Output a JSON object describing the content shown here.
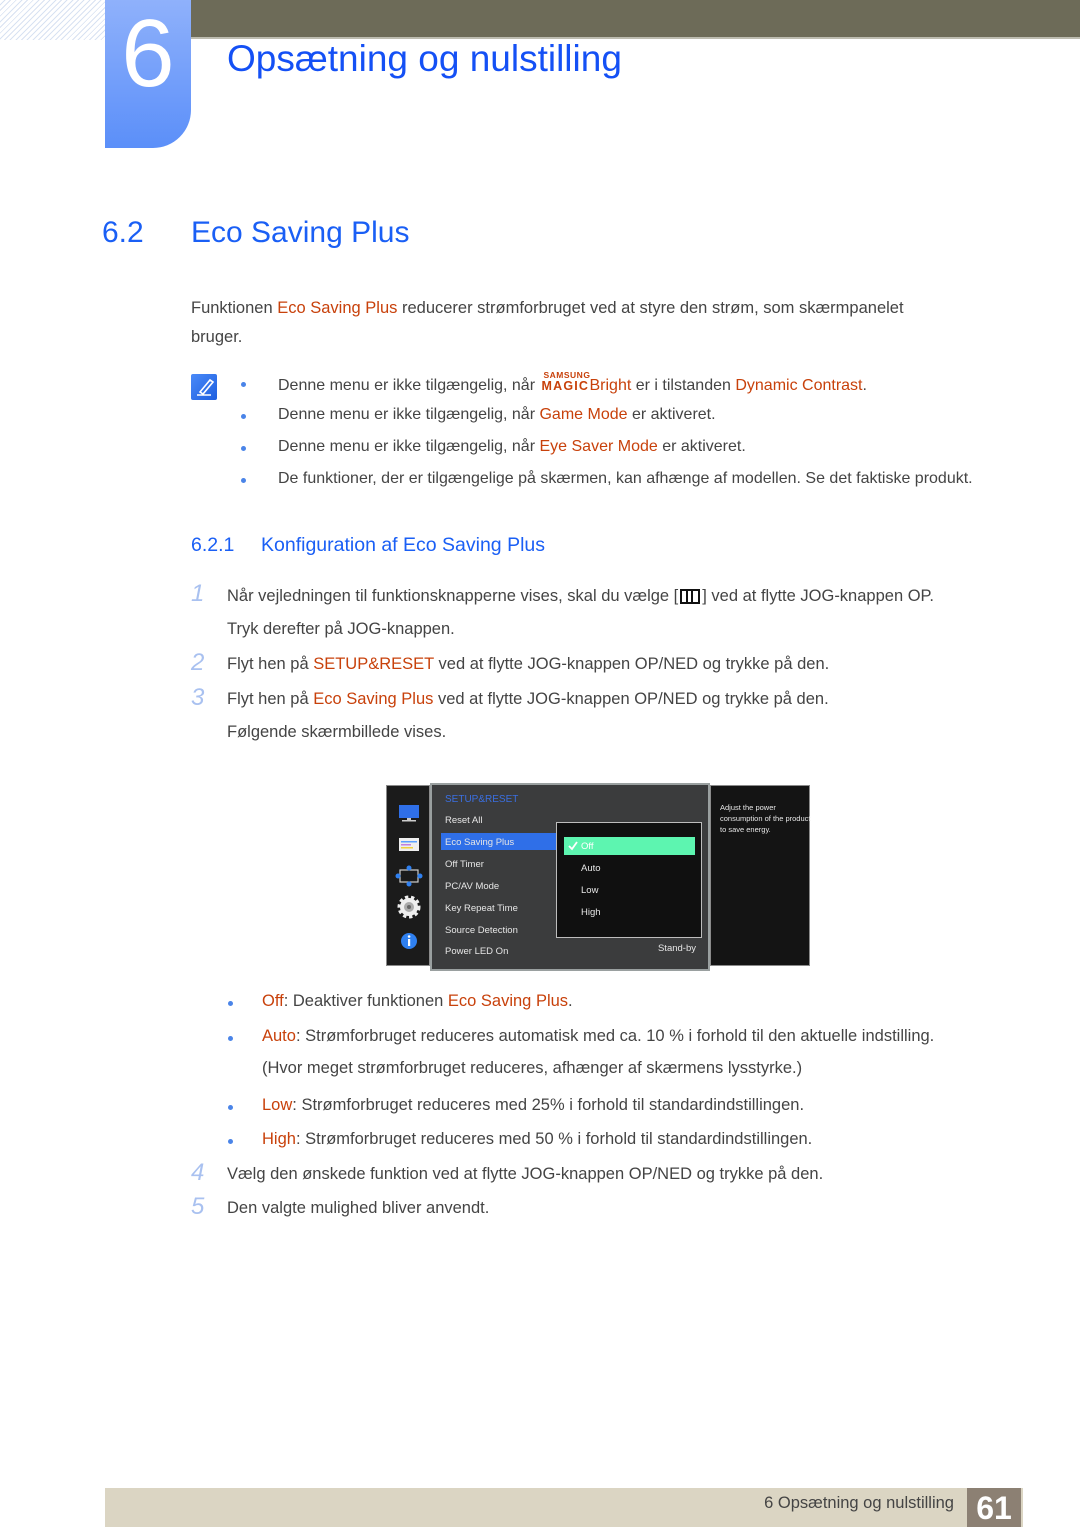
{
  "header": {
    "chapter_number": "6",
    "chapter_title": "Opsætning og nulstilling"
  },
  "section": {
    "number": "6.2",
    "title": "Eco Saving Plus"
  },
  "intro": {
    "pre": "Funktionen ",
    "highlight": "Eco Saving Plus",
    "post": " reducerer strømforbruget ved at styre den strøm, som skærmpanelet",
    "line2": "bruger."
  },
  "notes": [
    {
      "pre": "Denne menu er ikke tilgængelig, når ",
      "logo_top": "SAMSUNG",
      "logo_bottom": "MAGIC",
      "logo_word": "Bright",
      "mid": " er i tilstanden ",
      "highlight": "Dynamic Contrast",
      "post": "."
    },
    {
      "pre": "Denne menu er ikke tilgængelig, når ",
      "highlight": "Game Mode",
      "post": " er aktiveret."
    },
    {
      "pre": "Denne menu er ikke tilgængelig, når ",
      "highlight": "Eye Saver Mode",
      "post": " er aktiveret."
    },
    {
      "pre": "De funktioner, der er tilgængelige på skærmen, kan afhænge af modellen. Se det faktiske produkt."
    }
  ],
  "subsection": {
    "number": "6.2.1",
    "title": "Konfiguration af Eco Saving Plus"
  },
  "steps": [
    {
      "num": "1",
      "pre": "Når vejledningen til funktionsknapperne vises, skal du vælge [",
      "post": "] ved at flytte JOG-knappen OP.",
      "line2": "Tryk derefter på JOG-knappen."
    },
    {
      "num": "2",
      "pre": "Flyt hen på ",
      "highlight": "SETUP&RESET",
      "post": " ved at flytte JOG-knappen OP/NED og trykke på den."
    },
    {
      "num": "3",
      "pre": "Flyt hen på ",
      "highlight": "Eco Saving Plus",
      "post": " ved at flytte JOG-knappen OP/NED og trykke på den.",
      "line2": "Følgende skærmbillede vises."
    },
    {
      "num": "4",
      "pre": "Vælg den ønskede funktion ved at flytte JOG-knappen OP/NED og trykke på den."
    },
    {
      "num": "5",
      "pre": "Den valgte mulighed bliver anvendt."
    }
  ],
  "osd": {
    "header": "SETUP&RESET",
    "items": [
      "Reset All",
      "Eco Saving Plus",
      "Off Timer",
      "PC/AV Mode",
      "Key Repeat Time",
      "Source Detection",
      "Power LED On"
    ],
    "selected_item": "Eco Saving Plus",
    "power_led_value": "Stand-by",
    "submenu": [
      "Off",
      "Auto",
      "Low",
      "High"
    ],
    "submenu_selected": "Off",
    "help_text": "Adjust the power consumption of the product to save energy.",
    "side_icons": [
      "monitor-icon",
      "picture-settings-icon",
      "position-icon",
      "gear-icon",
      "info-icon"
    ]
  },
  "options": [
    {
      "label": "Off",
      "text": ": Deaktiver funktionen ",
      "highlight": "Eco Saving Plus",
      "post": "."
    },
    {
      "label": "Auto",
      "text": ": Strømforbruget reduceres automatisk med ca. 10 % i forhold til den aktuelle indstilling.",
      "line2": "(Hvor meget strømforbruget reduceres, afhænger af skærmens lysstyrke.)"
    },
    {
      "label": "Low",
      "text": ": Strømforbruget reduceres med 25% i forhold til standardindstillingen."
    },
    {
      "label": "High",
      "text": ": Strømforbruget reduceres med 50 % i forhold til standardindstillingen."
    }
  ],
  "footer": {
    "chapter_text": "6 Opsætning og nulstilling",
    "page": "61"
  }
}
